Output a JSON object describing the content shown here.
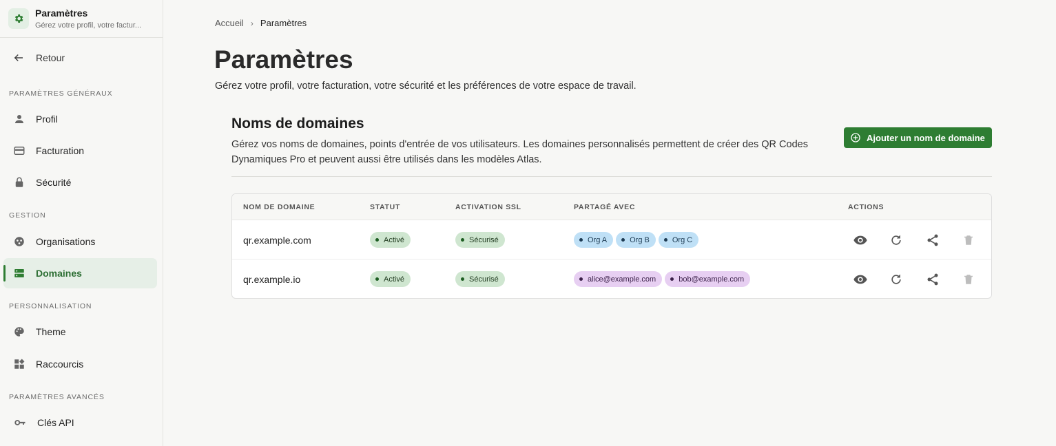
{
  "app": {
    "title": "Paramètres",
    "subtitle": "Gérez votre profil, votre factur...",
    "icon": "gear-icon"
  },
  "sidebar": {
    "back_label": "Retour",
    "sections": [
      {
        "label": "PARAMÈTRES GÉNÉRAUX",
        "items": [
          {
            "label": "Profil",
            "icon": "person-icon"
          },
          {
            "label": "Facturation",
            "icon": "credit-card-icon"
          },
          {
            "label": "Sécurité",
            "icon": "lock-icon"
          }
        ]
      },
      {
        "label": "GESTION",
        "items": [
          {
            "label": "Organisations",
            "icon": "organization-icon"
          },
          {
            "label": "Domaines",
            "icon": "dns-icon",
            "active": true
          }
        ]
      },
      {
        "label": "PERSONNALISATION",
        "items": [
          {
            "label": "Theme",
            "icon": "palette-icon"
          },
          {
            "label": "Raccourcis",
            "icon": "widgets-icon"
          }
        ]
      },
      {
        "label": "PARAMÈTRES AVANCÉS",
        "items": [
          {
            "label": "Clés API",
            "icon": "key-icon"
          }
        ]
      }
    ]
  },
  "breadcrumb": {
    "home": "Accueil",
    "current": "Paramètres"
  },
  "page": {
    "title": "Paramètres",
    "subtitle": "Gérez votre profil, votre facturation, votre sécurité et les préférences de votre espace de travail."
  },
  "domains": {
    "title": "Noms de domaines",
    "description": "Gérez vos noms de domaines, points d'entrée de vos utilisateurs. Les domaines personnalisés permettent de créer des QR Codes Dynamiques Pro et peuvent aussi être utilisés dans les modèles Atlas.",
    "add_button": "Ajouter un nom de domaine",
    "columns": [
      "NOM DE DOMAINE",
      "STATUT",
      "ACTIVATION SSL",
      "PARTAGÉ AVEC",
      "ACTIONS"
    ],
    "rows": [
      {
        "domain": "qr.example.com",
        "status": "Activé",
        "ssl": "Sécurisé",
        "shared": [
          "Org A",
          "Org B",
          "Org C"
        ],
        "shared_type": "org"
      },
      {
        "domain": "qr.example.io",
        "status": "Activé",
        "ssl": "Sécurisé",
        "shared": [
          "alice@example.com",
          "bob@example.com"
        ],
        "shared_type": "user"
      }
    ]
  },
  "colors": {
    "accent": "#2e7d32",
    "status_bg": "#cfe6d0",
    "org_bg": "#bfe0f6",
    "user_bg": "#e7cff2"
  }
}
